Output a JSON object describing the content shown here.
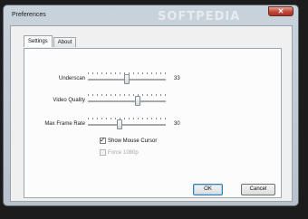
{
  "window": {
    "title": "Preferences",
    "watermark": "SOFTPEDIA"
  },
  "tabs": [
    {
      "label": "Settings",
      "active": true
    },
    {
      "label": "About",
      "active": false
    }
  ],
  "settings": {
    "sliders": [
      {
        "label": "Underscan",
        "value": "33",
        "level": 0.5
      },
      {
        "label": "Video Quality",
        "value": "",
        "level": 0.65
      },
      {
        "label": "Max Frame Rate",
        "value": "30",
        "level": 0.4
      }
    ],
    "checkboxes": [
      {
        "label": "Show Mouse Cursor",
        "checked": true,
        "enabled": true
      },
      {
        "label": "Force 1080p",
        "checked": false,
        "enabled": false
      }
    ]
  },
  "buttons": {
    "ok": "OK",
    "cancel": "Cancel"
  },
  "icons": {
    "close": "close-icon",
    "check": "check-mark-icon"
  }
}
